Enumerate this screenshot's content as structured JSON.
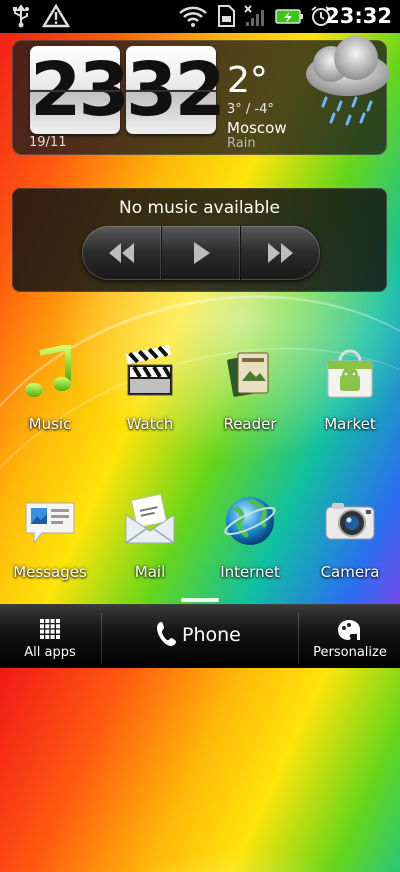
{
  "status_bar": {
    "time": "23:32",
    "icons": [
      "usb-icon",
      "warning-icon",
      "wifi-icon",
      "sd-card-icon",
      "no-signal-icon",
      "battery-charging-icon",
      "alarm-icon"
    ]
  },
  "clock_widget": {
    "hour": "23",
    "minute": "32",
    "date": "19/11",
    "temperature": "2°",
    "range": "3° / -4°",
    "city": "Moscow",
    "condition": "Rain",
    "weather_icon": "rain-cloud-icon"
  },
  "music_widget": {
    "title": "No music available",
    "controls": [
      "previous-icon",
      "play-icon",
      "next-icon"
    ]
  },
  "apps": [
    {
      "label": "Music",
      "icon": "music-note-icon"
    },
    {
      "label": "Watch",
      "icon": "clapperboard-icon"
    },
    {
      "label": "Reader",
      "icon": "books-icon"
    },
    {
      "label": "Market",
      "icon": "market-bag-icon"
    },
    {
      "label": "Messages",
      "icon": "message-bubble-icon"
    },
    {
      "label": "Mail",
      "icon": "envelope-icon"
    },
    {
      "label": "Internet",
      "icon": "globe-icon"
    },
    {
      "label": "Camera",
      "icon": "camera-icon"
    }
  ],
  "dock": {
    "all_apps": "All apps",
    "phone": "Phone",
    "personalize": "Personalize"
  },
  "colors": {
    "widget_bg": "#1e1e1e",
    "dock_bg": "#151515",
    "battery": "#3ec51a"
  }
}
